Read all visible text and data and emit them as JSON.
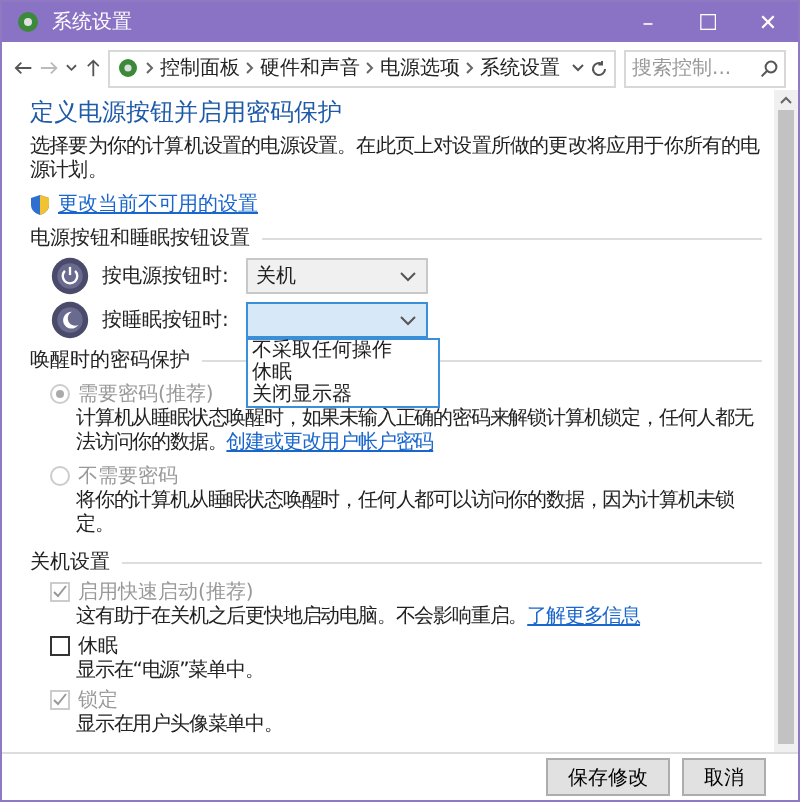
{
  "window": {
    "title": "系统设置",
    "controls": [
      "–",
      "☐",
      "✕"
    ]
  },
  "nav": {
    "breadcrumbs": [
      "控制面板",
      "硬件和声音",
      "电源选项",
      "系统设置"
    ],
    "search": {
      "placeholder": "搜索控制..."
    }
  },
  "heading": "定义电源按钮并启用密码保护",
  "description": "选择要为你的计算机设置的电源设置。在此页上对设置所做的更改将应用于你所有的电源计划。",
  "admin_link": "更改当前不可用的设置",
  "button_section": {
    "title": "电源按钮和睡眠按钮设置",
    "rows": [
      {
        "kind": "power",
        "label": "按电源按钮时:",
        "value": "关机",
        "expanded": false
      },
      {
        "kind": "sleep",
        "label": "按睡眠按钮时:",
        "expanded": true,
        "options": [
          "不采取任何操作",
          "休眠",
          "关闭显示器"
        ]
      }
    ]
  },
  "password_section": {
    "title": "唤醒时的密码保护",
    "options": [
      {
        "label": "需要密码(推荐)",
        "selected": true,
        "disabled": true,
        "description": "计算机从睡眠状态唤醒时，如果未输入正确的密码来解锁计算机锁定，任何人都无法访问你的数据。",
        "link": "创建或更改用户帐户密码"
      },
      {
        "label": "不需要密码",
        "selected": false,
        "disabled": true,
        "description": "将你的计算机从睡眠状态唤醒时，任何人都可以访问你的数据，因为计算机未锁定。"
      }
    ]
  },
  "shutdown_section": {
    "title": "关机设置",
    "items": [
      {
        "label": "启用快速启动(推荐)",
        "checked": true,
        "disabled": true,
        "description": "这有助于在关机之后更快地启动电脑。不会影响重启。",
        "link": "了解更多信息"
      },
      {
        "label": "休眠",
        "checked": false,
        "disabled": false,
        "description": "显示在“电源”菜单中。"
      },
      {
        "label": "锁定",
        "checked": true,
        "disabled": true,
        "description": "显示在用户头像菜单中。"
      }
    ]
  },
  "buttons": [
    "保存修改",
    "取消"
  ]
}
